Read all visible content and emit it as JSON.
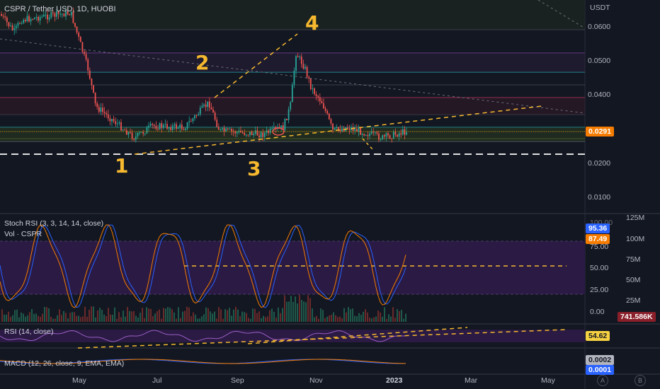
{
  "header": {
    "symbol": "CSPR / Tether USD, 1D, HUOBI"
  },
  "colors": {
    "background": "#131722",
    "bull": "#26a69a",
    "bear": "#ef5350",
    "accent_orange": "#f5b82e",
    "price_tag": "#f57c00",
    "rsi_band": "#2a1a44"
  },
  "price_axis": {
    "unit": "USDT",
    "ticks": [
      "0.0600",
      "0.0500",
      "0.0400",
      "0.0200",
      "0.0100"
    ],
    "last_price": "0.0291"
  },
  "wave_labels": [
    "1",
    "2",
    "3",
    "4"
  ],
  "stoch_pane": {
    "title": "Stoch RSI (3, 3, 14, 14, close)",
    "vol_title": "Vol · CSPR",
    "ticks": [
      "75.00",
      "50.00",
      "25.00",
      "0.00"
    ],
    "top_tick": "100.00",
    "k_value": "95.36",
    "d_value": "87.49",
    "vol_ticks": [
      "125M",
      "100M",
      "75M",
      "50M",
      "25M"
    ],
    "vol_value": "741.586K"
  },
  "rsi_pane": {
    "title": "RSI (14, close)",
    "value": "54.62"
  },
  "macd_pane": {
    "title": "MACD (12, 26, close, 9, EMA, EMA)",
    "value1": "0.0002",
    "value2": "0.0001"
  },
  "time_axis": {
    "labels": [
      "May",
      "Jul",
      "Sep",
      "Nov",
      "2023",
      "Mar",
      "May"
    ]
  },
  "corner_buttons": [
    "A",
    "B"
  ]
}
